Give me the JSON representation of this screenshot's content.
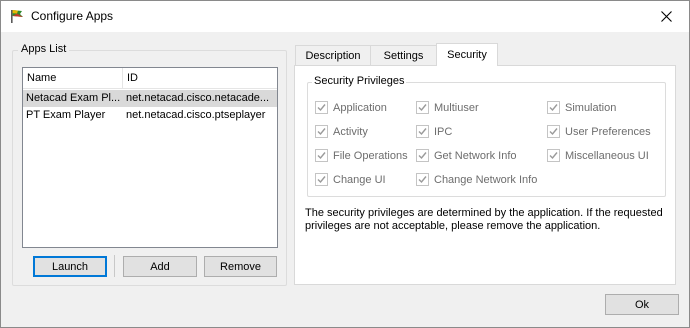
{
  "window": {
    "title": "Configure Apps"
  },
  "apps_list": {
    "label": "Apps List",
    "columns": [
      "Name",
      "ID"
    ],
    "rows": [
      {
        "name": "Netacad Exam Pl...",
        "id": "net.netacad.cisco.netacade...",
        "selected": true
      },
      {
        "name": "PT Exam Player",
        "id": "net.netacad.cisco.ptseplayer",
        "selected": false
      }
    ],
    "buttons": {
      "launch": "Launch",
      "add": "Add",
      "remove": "Remove"
    }
  },
  "tabs": [
    {
      "label": "Description",
      "active": false
    },
    {
      "label": "Settings",
      "active": false
    },
    {
      "label": "Security",
      "active": true
    }
  ],
  "security": {
    "group_label": "Security Privileges",
    "privileges": [
      {
        "label": "Application",
        "checked": true
      },
      {
        "label": "Multiuser",
        "checked": true
      },
      {
        "label": "Simulation",
        "checked": true
      },
      {
        "label": "Activity",
        "checked": true
      },
      {
        "label": "IPC",
        "checked": true
      },
      {
        "label": "User Preferences",
        "checked": true
      },
      {
        "label": "File Operations",
        "checked": true
      },
      {
        "label": "Get Network Info",
        "checked": true
      },
      {
        "label": "Miscellaneous UI",
        "checked": true
      },
      {
        "label": "Change UI",
        "checked": true
      },
      {
        "label": "Change Network Info",
        "checked": true
      }
    ],
    "note_line1": "The security privileges are determined by the application. If the requested",
    "note_line2": "privileges are not acceptable, please remove the application."
  },
  "footer": {
    "ok": "Ok"
  },
  "colors": {
    "accent": "#0078d7",
    "selection": "#d9d9d9",
    "disabled_text": "#6d6d6d"
  }
}
